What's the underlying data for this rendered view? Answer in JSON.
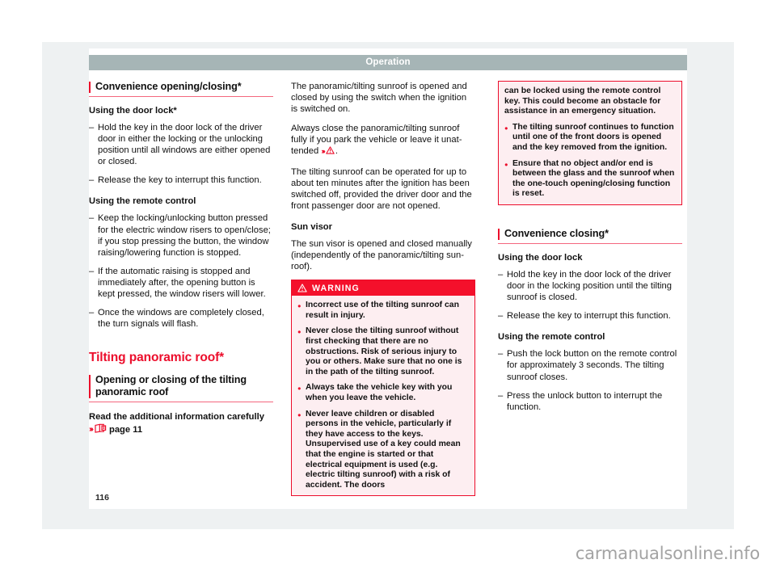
{
  "header": {
    "running_title": "Operation"
  },
  "folio": {
    "page_number": "116"
  },
  "watermark": {
    "text": "carmanualsonline.info"
  },
  "columns": {
    "left": {
      "section_heading": "Convenience opening/closing*",
      "sub_head_1": "Using the door lock*",
      "list_1": [
        "Hold the key in the door lock of the driver door in either the locking or the unlocking position until all windows are either opened or closed.",
        "Release the key to interrupt this function."
      ],
      "sub_head_2": "Using the remote control",
      "list_2": [
        "Keep the locking/unlocking button pressed for the electric window risers to open/close; if you stop pressing the button, the window raising/lowering function is stopped.",
        "If the automatic raising is stopped and immediately after, the opening button is kept pressed, the window risers will lower.",
        "Once the windows are completely closed, the turn signals will flash."
      ],
      "chapter_title": "Tilting panoramic roof*",
      "section_heading_2": "Opening or closing of the tilting panoramic roof",
      "read_info_line": "Read the additional information carefully",
      "reference_chevron": "›››",
      "reference_icon": "book-reference-icon",
      "reference_page": "page 11"
    },
    "middle": {
      "para_1": "The panoramic/tilting sunroof is opened and closed by using the switch when the ignition is switched on.",
      "para_2_before": "Always close the panoramic/tilting sunroof fully if you park the vehicle or leave it unat-tended ",
      "para_2_chevron": "›››",
      "para_2_icon": "warning-triangle-icon",
      "para_2_after": ".",
      "para_3": "The tilting sunroof can be operated for up to about ten minutes after the ignition has been switched off, provided the driver door and the front passenger door are not opened.",
      "sub_head_1": "Sun visor",
      "para_4": "The sun visor is opened and closed manually (independently of the panoramic/tilting sun-roof).",
      "warning": {
        "icon": "warning-triangle-icon",
        "title": "WARNING",
        "items": [
          "Incorrect use of the tilting sunroof can result in injury.",
          "Never close the tilting sunroof without first checking that there are no obstructions. Risk of serious injury to you or others. Make sure that no one is in the path of the tilting sunroof.",
          "Always take the vehicle key with you when you leave the vehicle.",
          "Never leave children or disabled persons in the vehicle, particularly if they have access to the keys. Unsupervised use of a key could mean that the engine is started or that electrical equipment is used (e.g. electric tilting sunroof) with a risk of accident. The doors"
        ]
      }
    },
    "right": {
      "warning_cont": {
        "lead": "can be locked using the remote control key. This could become an obstacle for assistance in an emergency situation.",
        "items": [
          "The tilting sunroof continues to function until one of the front doors is opened and the key removed from the ignition.",
          "Ensure that no object and/or end is between the glass and the sunroof when the one-touch opening/closing function is reset."
        ]
      },
      "section_heading": "Convenience closing*",
      "sub_head_1": "Using the door lock",
      "list_1": [
        "Hold the key in the door lock of the driver door in the locking position until the tilting sunroof is closed.",
        "Release the key to interrupt this function."
      ],
      "sub_head_2": "Using the remote control",
      "list_2": [
        "Push the lock button on the remote control for approximately 3 seconds. The tilting sunroof closes.",
        "Press the unlock button to interrupt the function."
      ]
    }
  },
  "colors": {
    "accent_red": "#ec0d2b",
    "warning_head": "#f4102b",
    "warning_body_bg": "#fdeef1",
    "running_head_bg": "#a6b5b6",
    "page_frame_bg": "#eef1f2"
  }
}
